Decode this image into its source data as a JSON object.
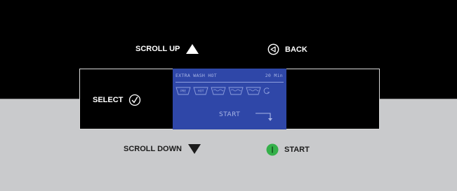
{
  "controls": {
    "scroll_up": "SCROLL UP",
    "back": "BACK",
    "select": "SELECT",
    "scroll_down": "SCROLL DOWN",
    "start": "START"
  },
  "display": {
    "program": "EXTRA WASH HOT",
    "time": "20 Min",
    "start": "START",
    "stages": [
      "PRE",
      "HOT",
      "",
      "",
      ""
    ]
  },
  "colors": {
    "top_panel": "#000000",
    "bottom_panel": "#c9cacc",
    "lcd_background": "#2f47a8",
    "lcd_text": "#a9b6e6",
    "start_button": "#35b04a"
  }
}
